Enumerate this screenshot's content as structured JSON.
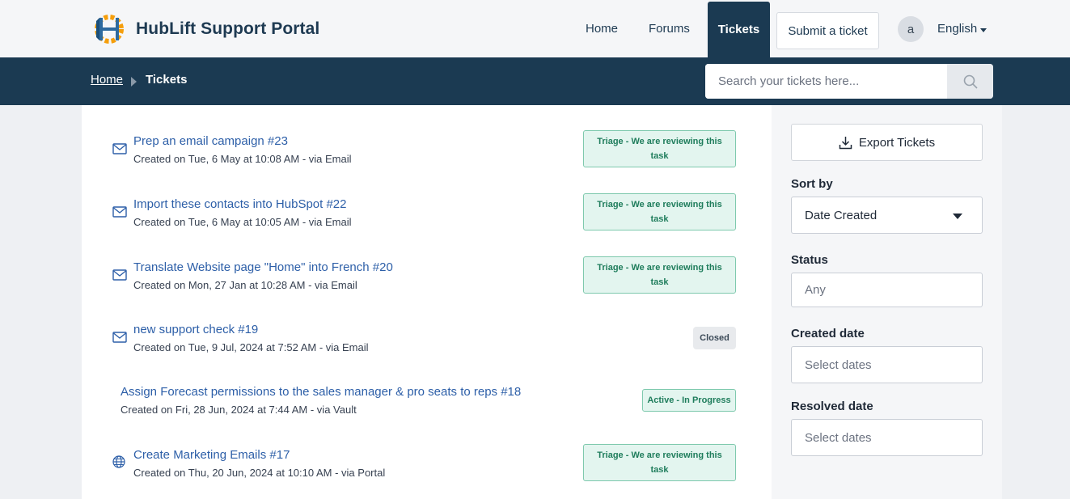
{
  "header": {
    "brand": "HubLift Support Portal",
    "nav": [
      {
        "label": "Home"
      },
      {
        "label": "Forums"
      },
      {
        "label": "Tickets"
      }
    ],
    "submit_label": "Submit a ticket",
    "avatar_initial": "a",
    "language": "English"
  },
  "breadcrumb": {
    "home": "Home",
    "current": "Tickets"
  },
  "search": {
    "placeholder": "Search your tickets here..."
  },
  "tickets": [
    {
      "title": "Prep an email campaign #23",
      "meta": "Created on Tue, 6 May at 10:08 AM - via Email",
      "icon": "mail-icon",
      "status": "Triage - We are reviewing this task"
    },
    {
      "title": "Import these contacts into HubSpot #22",
      "meta": "Created on Tue, 6 May at 10:05 AM - via Email",
      "icon": "mail-icon",
      "status": "Triage - We are reviewing this task"
    },
    {
      "title": "Translate Website page \"Home\" into French #20",
      "meta": "Created on Mon, 27 Jan at 10:28 AM - via Email",
      "icon": "mail-icon",
      "status": "Triage - We are reviewing this task"
    },
    {
      "title": "new support check #19",
      "meta": "Created on Tue, 9 Jul, 2024 at 7:52 AM - via Email",
      "icon": "mail-icon",
      "status": "Closed"
    },
    {
      "title": "Assign Forecast permissions to the sales manager & pro seats to reps #18",
      "meta": "Created on Fri, 28 Jun, 2024 at 7:44 AM - via Vault",
      "icon": "",
      "status": "Active - In Progress"
    },
    {
      "title": "Create Marketing Emails #17",
      "meta": "Created on Thu, 20 Jun, 2024 at 10:10 AM - via Portal",
      "icon": "globe-icon",
      "status": "Triage - We are reviewing this task"
    }
  ],
  "sidebar": {
    "export_label": "Export Tickets",
    "sort_label": "Sort by",
    "sort_value": "Date Created",
    "status_label": "Status",
    "status_placeholder": "Any",
    "created_label": "Created date",
    "created_placeholder": "Select dates",
    "resolved_label": "Resolved date",
    "resolved_placeholder": "Select dates"
  },
  "colors": {
    "brand_dark": "#1b3a52",
    "link": "#2d5fa8",
    "triage_bg": "#e3f5ef",
    "triage_text": "#1f7d5c"
  }
}
